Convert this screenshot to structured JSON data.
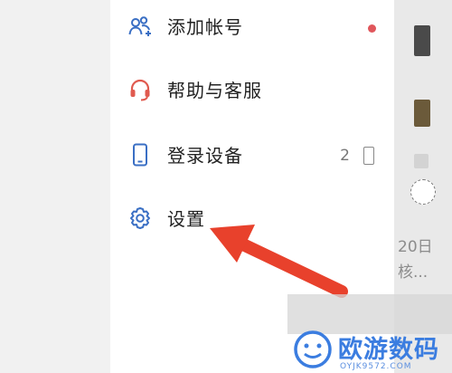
{
  "menu": {
    "items": [
      {
        "label": "添加帐号",
        "icon": "add-account-icon",
        "badge_dot": true
      },
      {
        "label": "帮助与客服",
        "icon": "headset-icon"
      },
      {
        "label": "登录设备",
        "icon": "phone-icon",
        "count": "2"
      },
      {
        "label": "设置",
        "icon": "gear-icon"
      }
    ]
  },
  "side": {
    "date_text": "20日",
    "sub_text": "核..."
  },
  "watermark": {
    "brand": "欧游数码",
    "sub": "OYJK9572.COM"
  },
  "colors": {
    "icon_blue": "#3a6fc4",
    "icon_red": "#e05a4f",
    "dot_red": "#e0565b",
    "arrow_red": "#e8412c",
    "brand_blue": "#3b7de0"
  }
}
